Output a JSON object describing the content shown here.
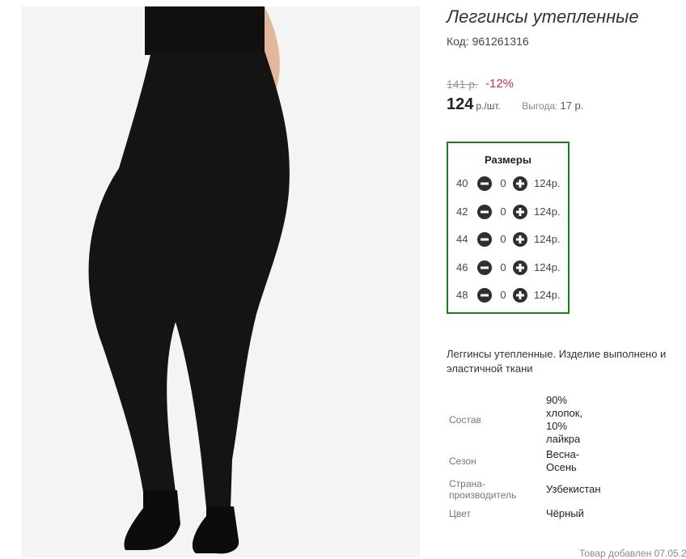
{
  "product": {
    "title": "Леггинсы утепленные",
    "code": "Код: 961261316",
    "old_price": "141 р.",
    "discount": "-12%",
    "price": "124",
    "price_unit": "р./шт.",
    "saving_label": "Выгода:",
    "saving_value": "17 р.",
    "photo_icon": "leggings-photo"
  },
  "sizes": {
    "title": "Размеры",
    "items": [
      {
        "size": "40",
        "qty": "0",
        "price": "124р."
      },
      {
        "size": "42",
        "qty": "0",
        "price": "124р."
      },
      {
        "size": "44",
        "qty": "0",
        "price": "124р."
      },
      {
        "size": "46",
        "qty": "0",
        "price": "124р."
      },
      {
        "size": "48",
        "qty": "0",
        "price": "124р."
      }
    ],
    "minus_icon": "minus-circle-icon",
    "plus_icon": "plus-circle-icon"
  },
  "description": "Леггинсы утепленные. Изделие выполнено и эластичной ткани",
  "specs": [
    {
      "name": "Состав",
      "value": "90% хлопок, 10% лайкра"
    },
    {
      "name": "Сезон",
      "value": "Весна-Осень"
    },
    {
      "name": "Страна-производитель",
      "value": "Узбекистан"
    },
    {
      "name": "Цвет",
      "value": "Чёрный"
    }
  ],
  "added_date": "Товар добавлен 07.05.2",
  "colors": {
    "accent_border": "#1a7f1a",
    "discount": "#d6304f",
    "button": "#2f2f2f"
  }
}
